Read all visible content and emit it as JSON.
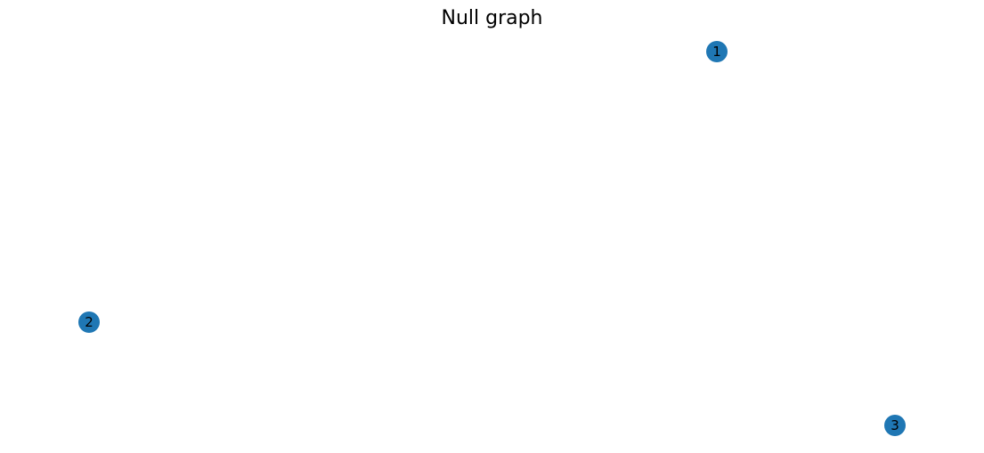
{
  "title": "Null graph",
  "graph": {
    "node_color": "#1f77b4",
    "label_color": "#000000",
    "nodes": [
      {
        "id": "1",
        "label": "1"
      },
      {
        "id": "2",
        "label": "2"
      },
      {
        "id": "3",
        "label": "3"
      }
    ],
    "edges": []
  }
}
